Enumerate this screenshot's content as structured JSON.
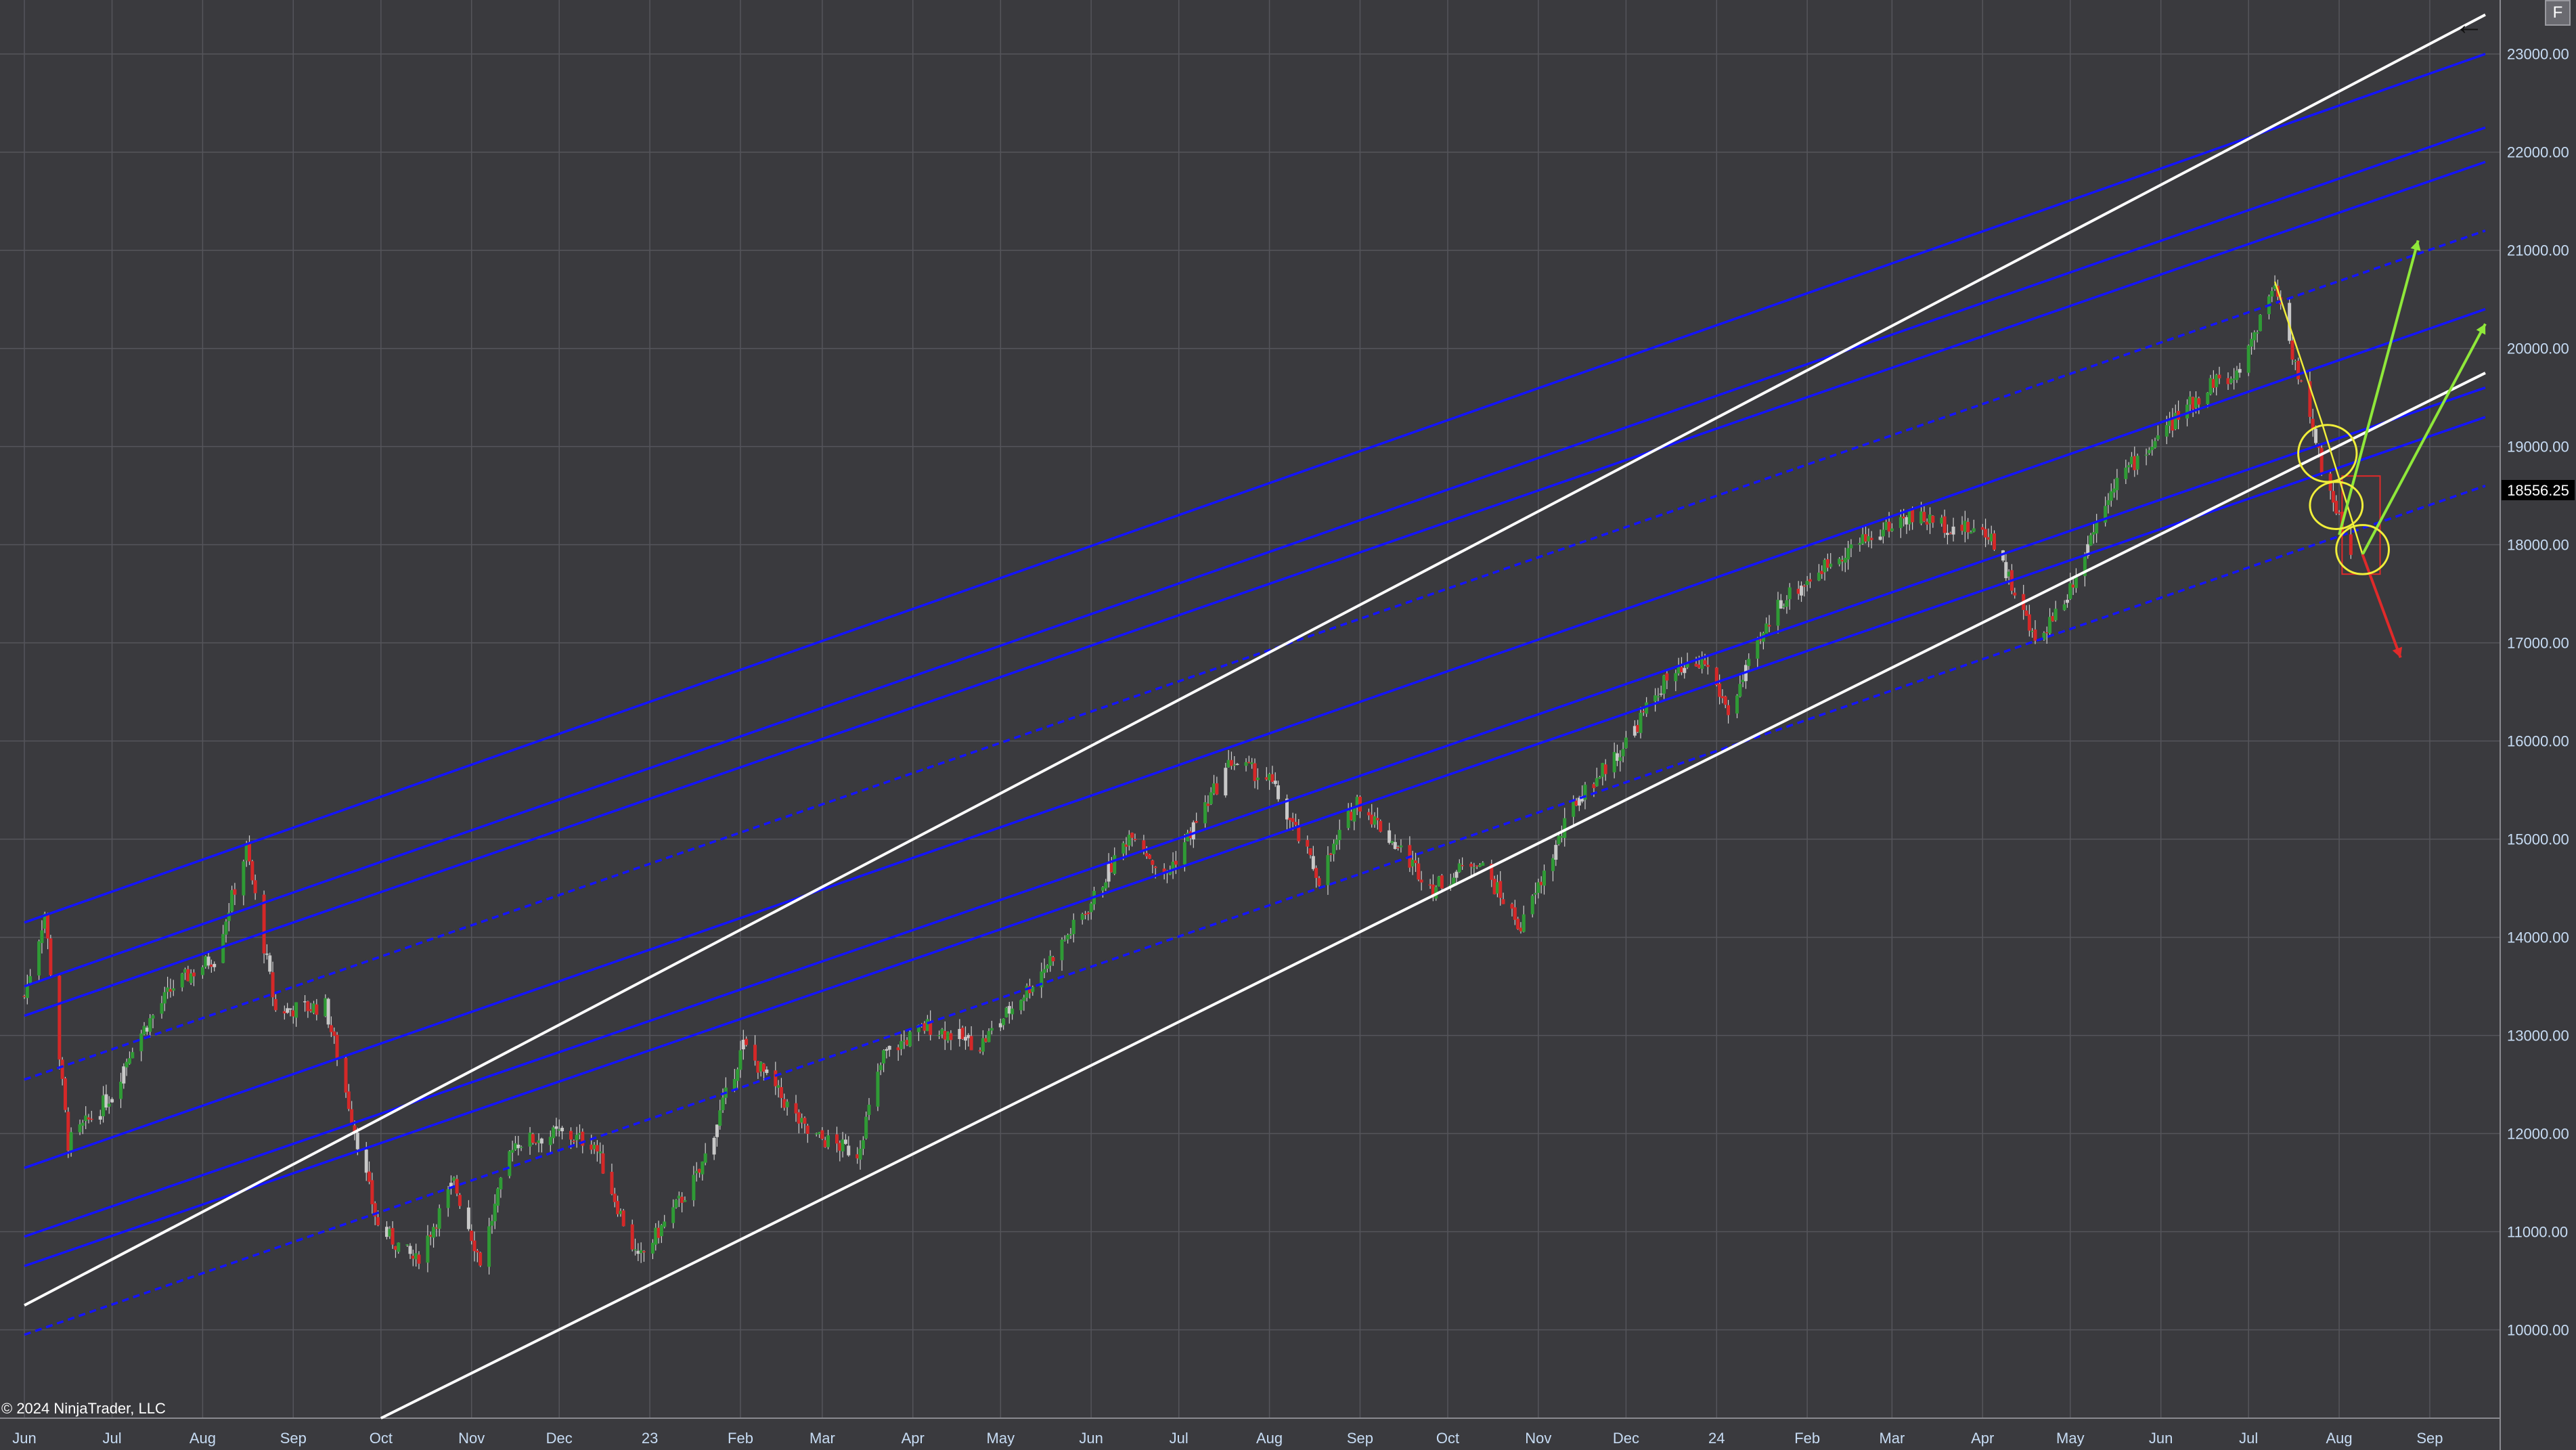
{
  "toolbar": {
    "back_icon": "←",
    "f_label": "F"
  },
  "watermark": "© 2024 NinjaTrader, LLC",
  "colors": {
    "background": "#3a3a3e",
    "grid": "#55555b",
    "axis_text": "#c7dcf4",
    "up_candle": "#2f9a35",
    "down_candle": "#d42828",
    "neutral_candle": "#c8c8c8",
    "channel_blue": "#1414ff",
    "trend_white": "#ffffff",
    "arrow_green": "#8fe83a",
    "arrow_yellow": "#f0ee3a",
    "arrow_red": "#e02a2a",
    "price_marker_bg": "#000000"
  },
  "chart_data": {
    "type": "candlestick",
    "y_axis_labels": [
      "23000.00",
      "22000.00",
      "21000.00",
      "20000.00",
      "19000.00",
      "18000.00",
      "17000.00",
      "16000.00",
      "15000.00",
      "14000.00",
      "13000.00",
      "12000.00",
      "11000.00",
      "10000.00"
    ],
    "ylim": [
      9100,
      23550
    ],
    "current_price": 18556.25,
    "current_price_label": "18556.25",
    "x_axis_labels": [
      "Jun",
      "Jul",
      "Aug",
      "Sep",
      "Oct",
      "Nov",
      "Dec",
      "23",
      "Feb",
      "Mar",
      "Apr",
      "May",
      "Jun",
      "Jul",
      "Aug",
      "Sep",
      "Oct",
      "Nov",
      "Dec",
      "24",
      "Feb",
      "Mar",
      "Apr",
      "May",
      "Jun",
      "Jul",
      "Aug",
      "Sep"
    ],
    "x_months": [
      "2022-06",
      "2022-07",
      "2022-08",
      "2022-09",
      "2022-10",
      "2022-11",
      "2022-12",
      "2023-01",
      "2023-02",
      "2023-03",
      "2023-04",
      "2023-05",
      "2023-06",
      "2023-07",
      "2023-08",
      "2023-09",
      "2023-10",
      "2023-11",
      "2023-12",
      "2024-01",
      "2024-02",
      "2024-03",
      "2024-04",
      "2024-05",
      "2024-06",
      "2024-07",
      "2024-08",
      "2024-09"
    ],
    "price_path": [
      [
        "2022-06-01",
        13400
      ],
      [
        "2022-06-08",
        14250
      ],
      [
        "2022-06-16",
        11900
      ],
      [
        "2022-07-01",
        12400
      ],
      [
        "2022-07-08",
        12900
      ],
      [
        "2022-07-22",
        13500
      ],
      [
        "2022-08-05",
        13800
      ],
      [
        "2022-08-16",
        14900
      ],
      [
        "2022-08-26",
        13250
      ],
      [
        "2022-09-12",
        13300
      ],
      [
        "2022-09-30",
        11050
      ],
      [
        "2022-10-13",
        10700
      ],
      [
        "2022-10-26",
        11500
      ],
      [
        "2022-11-04",
        10700
      ],
      [
        "2022-11-15",
        11900
      ],
      [
        "2022-12-01",
        12000
      ],
      [
        "2022-12-13",
        11900
      ],
      [
        "2022-12-28",
        10700
      ],
      [
        "2023-01-18",
        11600
      ],
      [
        "2023-02-02",
        12900
      ],
      [
        "2023-02-24",
        12000
      ],
      [
        "2023-03-13",
        11800
      ],
      [
        "2023-03-22",
        12800
      ],
      [
        "2023-04-06",
        13100
      ],
      [
        "2023-04-24",
        12900
      ],
      [
        "2023-05-11",
        13500
      ],
      [
        "2023-05-31",
        14300
      ],
      [
        "2023-06-15",
        15100
      ],
      [
        "2023-06-26",
        14600
      ],
      [
        "2023-07-19",
        15800
      ],
      [
        "2023-08-01",
        15600
      ],
      [
        "2023-08-18",
        14600
      ],
      [
        "2023-08-31",
        15400
      ],
      [
        "2023-09-26",
        14500
      ],
      [
        "2023-10-11",
        14800
      ],
      [
        "2023-10-26",
        14100
      ],
      [
        "2023-11-14",
        15400
      ],
      [
        "2023-11-29",
        15900
      ],
      [
        "2023-12-14",
        16600
      ],
      [
        "2023-12-28",
        16800
      ],
      [
        "2024-01-05",
        16300
      ],
      [
        "2024-01-22",
        17400
      ],
      [
        "2024-02-12",
        17900
      ],
      [
        "2024-03-07",
        18300
      ],
      [
        "2024-03-20",
        18200
      ],
      [
        "2024-04-04",
        18100
      ],
      [
        "2024-04-19",
        17000
      ],
      [
        "2024-04-30",
        17500
      ],
      [
        "2024-05-15",
        18600
      ],
      [
        "2024-06-20",
        19700
      ],
      [
        "2024-06-26",
        19650
      ],
      [
        "2024-07-10",
        20680
      ],
      [
        "2024-07-25",
        18900
      ],
      [
        "2024-08-05",
        17900
      ]
    ],
    "trend_lines": {
      "channel": [
        {
          "from": [
            "2022-06-01",
            14150
          ],
          "to": [
            "2024-09-20",
            23000
          ],
          "dashed": false
        },
        {
          "from": [
            "2022-06-01",
            13500
          ],
          "to": [
            "2024-09-20",
            22250
          ],
          "dashed": false
        },
        {
          "from": [
            "2022-06-01",
            13200
          ],
          "to": [
            "2024-09-20",
            21900
          ],
          "dashed": false
        },
        {
          "from": [
            "2022-06-01",
            12550
          ],
          "to": [
            "2024-09-20",
            21200
          ],
          "dashed": true
        },
        {
          "from": [
            "2022-06-01",
            11650
          ],
          "to": [
            "2024-09-20",
            20400
          ],
          "dashed": false
        },
        {
          "from": [
            "2022-06-01",
            10950
          ],
          "to": [
            "2024-09-20",
            19600
          ],
          "dashed": false
        },
        {
          "from": [
            "2022-06-01",
            10650
          ],
          "to": [
            "2024-09-20",
            19300
          ],
          "dashed": false
        },
        {
          "from": [
            "2022-06-01",
            9950
          ],
          "to": [
            "2024-09-20",
            18600
          ],
          "dashed": true
        }
      ],
      "white": [
        {
          "from": [
            "2022-06-01",
            10250
          ],
          "to": [
            "2024-09-20",
            23400
          ]
        },
        {
          "from": [
            "2022-10-01",
            9100
          ],
          "to": [
            "2024-09-20",
            19750
          ]
        }
      ]
    },
    "annotations": {
      "green_arrows": [
        {
          "from": [
            "2024-08-01",
            18100
          ],
          "to": [
            "2024-08-28",
            21100
          ]
        },
        {
          "from": [
            "2024-08-09",
            17900
          ],
          "to": [
            "2024-09-20",
            20250
          ]
        }
      ],
      "yellow_path": [
        [
          "2024-07-10",
          20680
        ],
        [
          "2024-07-26",
          19250
        ],
        [
          "2024-08-09",
          17900
        ]
      ],
      "red_arrow": {
        "from": [
          "2024-08-09",
          17900
        ],
        "to": [
          "2024-08-22",
          16850
        ]
      },
      "yellow_circles": [
        {
          "center": [
            "2024-07-28",
            18930
          ],
          "r_days": 10,
          "r_price": 290
        },
        {
          "center": [
            "2024-07-31",
            18400
          ],
          "r_days": 9,
          "r_price": 240
        },
        {
          "center": [
            "2024-08-09",
            17950
          ],
          "r_days": 9,
          "r_price": 250
        }
      ],
      "red_box": {
        "from": [
          "2024-08-02",
          18700
        ],
        "to": [
          "2024-08-15",
          17700
        ]
      }
    },
    "grid": true
  }
}
